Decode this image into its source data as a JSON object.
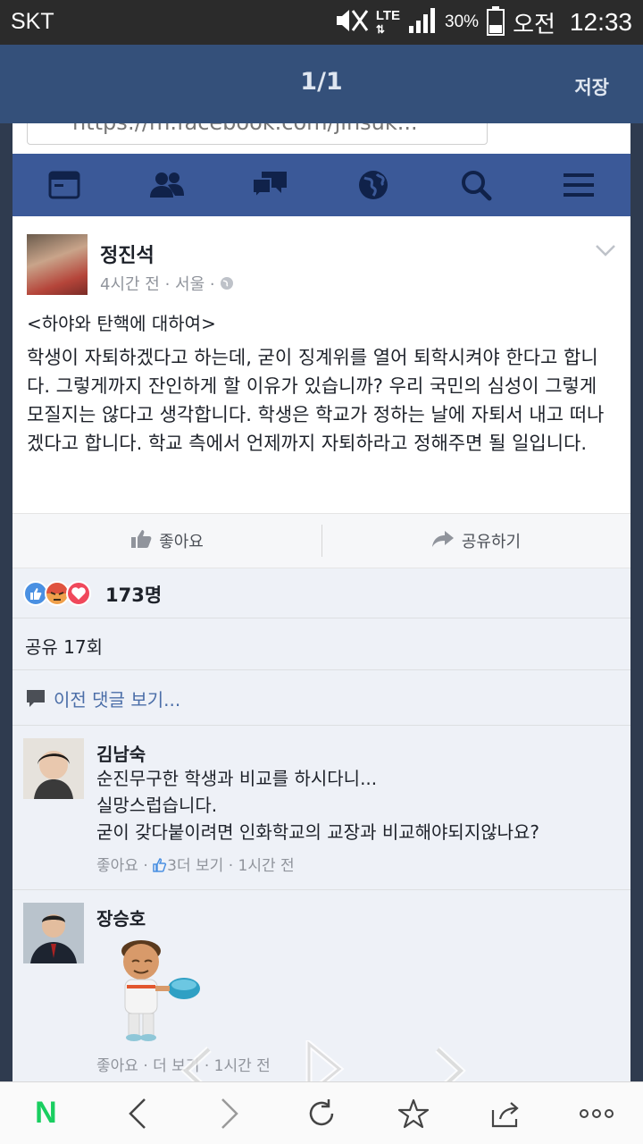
{
  "status_bar": {
    "carrier": "SKT",
    "network": "LTE",
    "battery": "30%",
    "ampm": "오전",
    "time": "12:33"
  },
  "viewer": {
    "pager": "1/1",
    "save_label": "저장"
  },
  "browser": {
    "url": "https://m.facebook.com/jinsuk..."
  },
  "fb_nav": {
    "icons": [
      "news-feed-icon",
      "friends-icon",
      "messages-icon",
      "globe-icon",
      "search-icon",
      "menu-icon"
    ]
  },
  "post": {
    "author": "정진석",
    "meta": "4시간 전 · 서울 ·",
    "title": "<하야와 탄핵에 대하여>",
    "body": "학생이 자퇴하겠다고 하는데, 굳이 징계위를 열어 퇴학시켜야 한다고 합니다. 그렇게까지 잔인하게 할 이유가 있습니까? 우리 국민의 심성이 그렇게 모질지는 않다고 생각합니다. 학생은 학교가 정하는 날에 자퇴서 내고 떠나겠다고 합니다. 학교 측에서 언제까지 자퇴하라고 정해주면 될 일입니다.",
    "like_label": "좋아요",
    "share_label": "공유하기",
    "reaction_count": "173명",
    "share_count": "공유 17회",
    "prev_comments": "이전 댓글 보기..."
  },
  "comments": [
    {
      "name": "김남숙",
      "lines": [
        "순진무구한 학생과 비교를 하시다니...",
        "실망스럽습니다.",
        "굳이 갖다붙이려면 인화학교의 교장과 비교해야되지않나요?"
      ],
      "meta_like": "좋아요 ·",
      "meta_count": "3",
      "meta_rest": "더 보기 · 1시간 전"
    },
    {
      "name": "장승호",
      "meta": "좋아요 · 더 보기 · 1시간 전"
    }
  ],
  "bottom_bar": {
    "home_label": "N",
    "icons": [
      "naver-home-icon",
      "back-icon",
      "forward-icon",
      "refresh-icon",
      "bookmark-star-icon",
      "share-icon",
      "more-icon"
    ]
  },
  "colors": {
    "facebook_blue": "#3b5998",
    "viewer_header": "#34507a",
    "naver_green": "#19ce60"
  }
}
